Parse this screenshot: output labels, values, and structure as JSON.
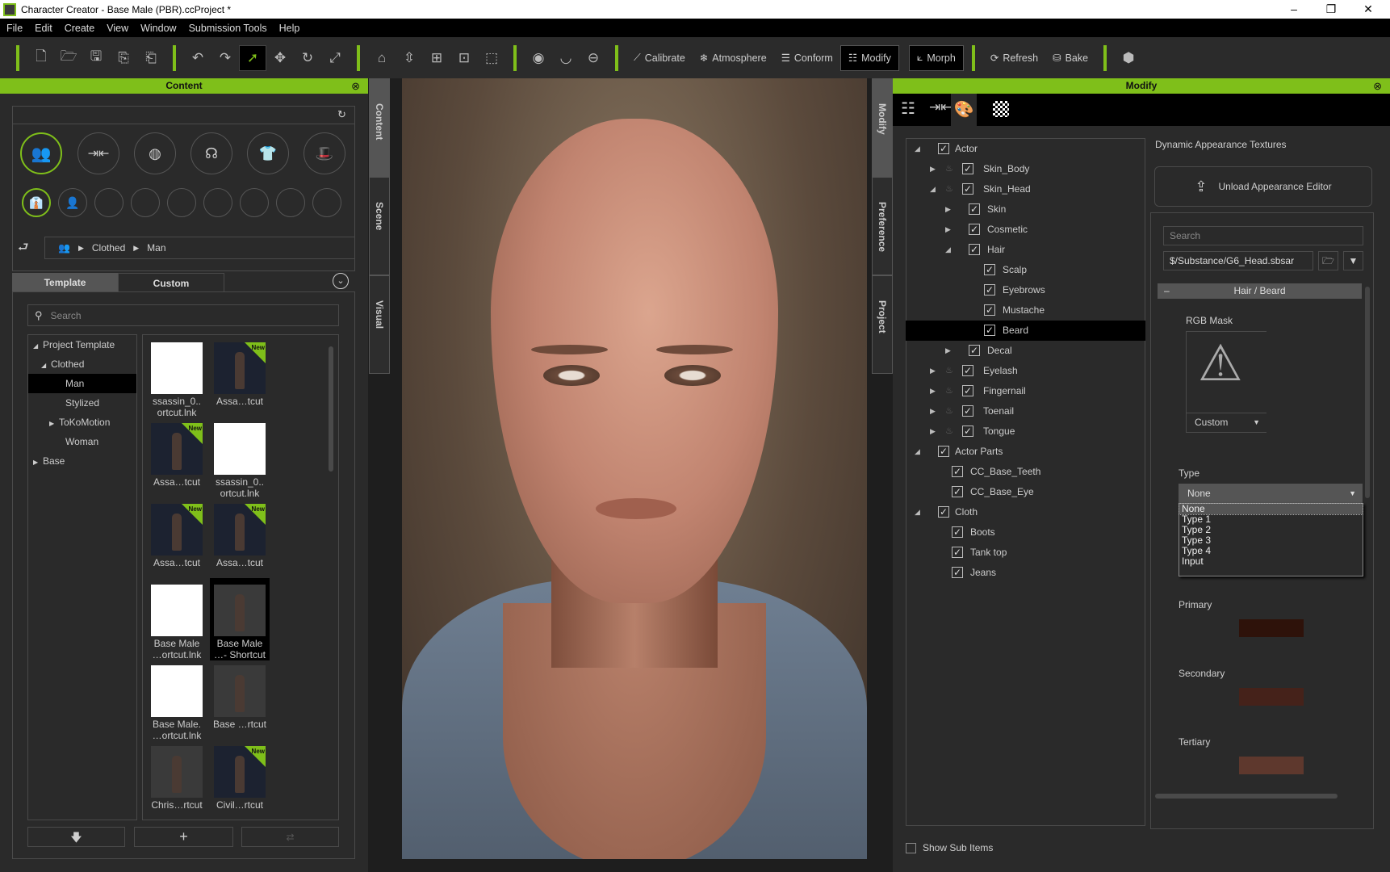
{
  "window": {
    "title": "Character Creator - Base Male (PBR).ccProject *",
    "minimize": "–",
    "maximize": "❐",
    "close": "✕"
  },
  "menu": [
    "File",
    "Edit",
    "Create",
    "View",
    "Window",
    "Submission Tools",
    "Help"
  ],
  "toolbar": {
    "calibrate": "Calibrate",
    "atmosphere": "Atmosphere",
    "conform": "Conform",
    "modify": "Modify",
    "morph": "Morph",
    "refresh": "Refresh",
    "bake": "Bake"
  },
  "content": {
    "title": "Content",
    "breadcrumb": [
      "Clothed",
      "Man"
    ],
    "tabs": [
      "Template",
      "Custom"
    ],
    "search_placeholder": "Search",
    "tree": [
      {
        "label": "Project Template",
        "level": 0,
        "state": "expanded"
      },
      {
        "label": "Clothed",
        "level": 1,
        "state": "expanded"
      },
      {
        "label": "Man",
        "level": 2,
        "state": "leaf",
        "selected": true
      },
      {
        "label": "Stylized",
        "level": 2,
        "state": "leaf"
      },
      {
        "label": "ToKoMotion",
        "level": 2,
        "state": "collapsed"
      },
      {
        "label": "Woman",
        "level": 2,
        "state": "leaf"
      },
      {
        "label": "Base",
        "level": 0,
        "state": "collapsed"
      }
    ],
    "items": [
      {
        "l1": "ssassin_0..",
        "l2": "ortcut.lnk",
        "thumb": "white"
      },
      {
        "l1": "Assa…tcut",
        "l2": "",
        "thumb": "dark",
        "new": true
      },
      {
        "l1": "Assa…tcut",
        "l2": "",
        "thumb": "dark",
        "new": true
      },
      {
        "l1": "ssassin_0..",
        "l2": "ortcut.lnk",
        "thumb": "white"
      },
      {
        "l1": "Assa…tcut",
        "l2": "",
        "thumb": "dark",
        "new": true
      },
      {
        "l1": "Assa…tcut",
        "l2": "",
        "thumb": "dark",
        "new": true
      },
      {
        "l1": "Base Male",
        "l2": "…ortcut.lnk",
        "thumb": "white"
      },
      {
        "l1": "Base Male",
        "l2": "…- Shortcut",
        "thumb": "gray",
        "selected": true
      },
      {
        "l1": "Base Male.",
        "l2": "…ortcut.lnk",
        "thumb": "white"
      },
      {
        "l1": "Base …rtcut",
        "l2": "",
        "thumb": "gray"
      },
      {
        "l1": "Chris…rtcut",
        "l2": "",
        "thumb": "gray"
      },
      {
        "l1": "Civil…rtcut",
        "l2": "",
        "thumb": "dark",
        "new": true
      }
    ],
    "new_badge": "New"
  },
  "left_vtabs": [
    "Content",
    "Scene",
    "Visual"
  ],
  "right_vtabs": [
    "Modify",
    "Preference",
    "Project"
  ],
  "modify": {
    "title": "Modify",
    "tree": [
      {
        "label": "Actor",
        "kind": "l0",
        "state": "expanded"
      },
      {
        "label": "Skin_Body",
        "kind": "l1",
        "state": "collapsed"
      },
      {
        "label": "Skin_Head",
        "kind": "l1",
        "state": "expanded"
      },
      {
        "label": "Skin",
        "kind": "l2",
        "state": "collapsed"
      },
      {
        "label": "Cosmetic",
        "kind": "l2",
        "state": "collapsed"
      },
      {
        "label": "Hair",
        "kind": "l2",
        "state": "expanded"
      },
      {
        "label": "Scalp",
        "kind": "l3",
        "state": "leaf"
      },
      {
        "label": "Eyebrows",
        "kind": "l3",
        "state": "leaf"
      },
      {
        "label": "Mustache",
        "kind": "l3",
        "state": "leaf"
      },
      {
        "label": "Beard",
        "kind": "l3",
        "state": "leaf",
        "selected": true
      },
      {
        "label": "Decal",
        "kind": "l2",
        "state": "collapsed"
      },
      {
        "label": "Eyelash",
        "kind": "l1",
        "state": "collapsed"
      },
      {
        "label": "Fingernail",
        "kind": "l1",
        "state": "collapsed"
      },
      {
        "label": "Toenail",
        "kind": "l1",
        "state": "collapsed"
      },
      {
        "label": "Tongue",
        "kind": "l1",
        "state": "collapsed"
      },
      {
        "label": "Actor Parts",
        "kind": "l0",
        "state": "expanded"
      },
      {
        "label": "CC_Base_Teeth",
        "kind": "c",
        "state": "leaf"
      },
      {
        "label": "CC_Base_Eye",
        "kind": "c",
        "state": "leaf"
      },
      {
        "label": "Cloth",
        "kind": "l0",
        "state": "expanded"
      },
      {
        "label": "Boots",
        "kind": "c",
        "state": "leaf"
      },
      {
        "label": "Tank top",
        "kind": "c",
        "state": "leaf"
      },
      {
        "label": "Jeans",
        "kind": "c",
        "state": "leaf"
      }
    ],
    "show_sub_items": "Show Sub Items",
    "dat_label": "Dynamic Appearance Textures",
    "unload_button": "Unload Appearance Editor",
    "search_placeholder": "Search",
    "path": "$/Substance/G6_Head.sbsar",
    "section": "Hair / Beard",
    "section_toggle": "–",
    "rgb_mask": "RGB Mask",
    "mask_select": "Custom",
    "type_label": "Type",
    "type_value": "None",
    "type_options": [
      "None",
      "Type 1",
      "Type 2",
      "Type 3",
      "Type 4",
      "Input"
    ],
    "primary": {
      "label": "Primary",
      "color": "#2e120a"
    },
    "secondary": {
      "label": "Secondary",
      "color": "#45221a"
    },
    "tertiary": {
      "label": "Tertiary",
      "color": "#5e382d"
    }
  },
  "colors": {
    "accent": "#7fbf1a"
  }
}
